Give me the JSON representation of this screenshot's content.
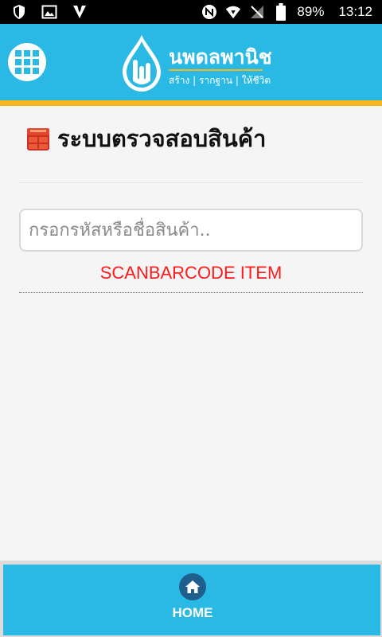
{
  "status_bar": {
    "battery": "89%",
    "time": "13:12"
  },
  "header": {
    "logo_title": "นพดลพานิช",
    "logo_subtitle": "สร้าง | รากฐาน | ให้ชีวิต"
  },
  "main": {
    "page_title": "ระบบตรวจสอบสินค้า",
    "search": {
      "placeholder": "กรอกรหัสหรือชื่อสินค้า..",
      "value": ""
    },
    "scan_link": "SCANBARCODE ITEM"
  },
  "bottom_nav": {
    "home_label": "HOME"
  },
  "colors": {
    "header_bg": "#29b9e4",
    "header_stripe": "#f6b71e",
    "scan_link": "#ff1a1a",
    "home_icon_bg": "#1f5f8b"
  },
  "icons": {
    "menu": "grid-menu-icon",
    "title": "boxes-icon",
    "home": "home-icon"
  }
}
